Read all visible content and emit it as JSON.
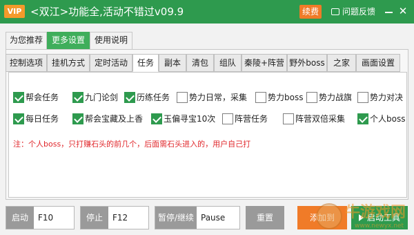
{
  "titlebar": {
    "vip": "VIP",
    "title": "<双江>功能全,活动不错过v09.9",
    "renew": "续费",
    "feedback": "问题反馈",
    "close": "✕"
  },
  "tabs_main": [
    {
      "label": "为您推荐",
      "active": false
    },
    {
      "label": "更多设置",
      "active": true
    },
    {
      "label": "使用说明",
      "active": false
    }
  ],
  "tabs_sub": [
    {
      "label": "控制选项",
      "active": false
    },
    {
      "label": "挂机方式",
      "active": false
    },
    {
      "label": "定时活动",
      "active": false
    },
    {
      "label": "任务",
      "active": true
    },
    {
      "label": "副本",
      "active": false
    },
    {
      "label": "清包",
      "active": false
    },
    {
      "label": "组队",
      "active": false
    },
    {
      "label": "秦陵+阵营",
      "active": false
    },
    {
      "label": "野外boss",
      "active": false
    },
    {
      "label": "之家",
      "active": false
    },
    {
      "label": "画面设置",
      "active": false
    }
  ],
  "options_row1": [
    {
      "label": "帮会任务",
      "checked": true
    },
    {
      "label": "九门论剑",
      "checked": true
    },
    {
      "label": "历练任务",
      "checked": true
    },
    {
      "label": "势力日常，采集",
      "checked": false
    },
    {
      "label": "势力boss",
      "checked": false
    },
    {
      "label": "势力战旗",
      "checked": false
    },
    {
      "label": "势力对决",
      "checked": false
    }
  ],
  "options_row2": [
    {
      "label": "每日任务",
      "checked": true
    },
    {
      "label": "帮会宝藏及上香",
      "checked": true
    },
    {
      "label": "玉偏寻宝10次",
      "checked": true
    },
    {
      "label": "阵营任务",
      "checked": false
    },
    {
      "label": "阵营双倍采集",
      "checked": false
    },
    {
      "label": "个人boss",
      "checked": true
    }
  ],
  "note": "注：个人boss，只打赚石头的前几个，后面需石头进入的，用户自己打",
  "controls": {
    "start_label": "启动",
    "start_key": "F10",
    "stop_label": "停止",
    "stop_key": "F12",
    "pause_label": "暂停/继续",
    "pause_key": "Pause",
    "reset_label": "重置",
    "add_label": "添加到",
    "launch_label": "启动工具"
  },
  "watermark": {
    "text": "牛游戏网",
    "url": "www.newyx.net"
  },
  "colors": {
    "title_green": "#2e9a4e",
    "vip_orange": "#f39a2b",
    "renew_orange": "#f07b28",
    "note_red": "#e0262a",
    "gray_button": "#9a9a9a"
  }
}
